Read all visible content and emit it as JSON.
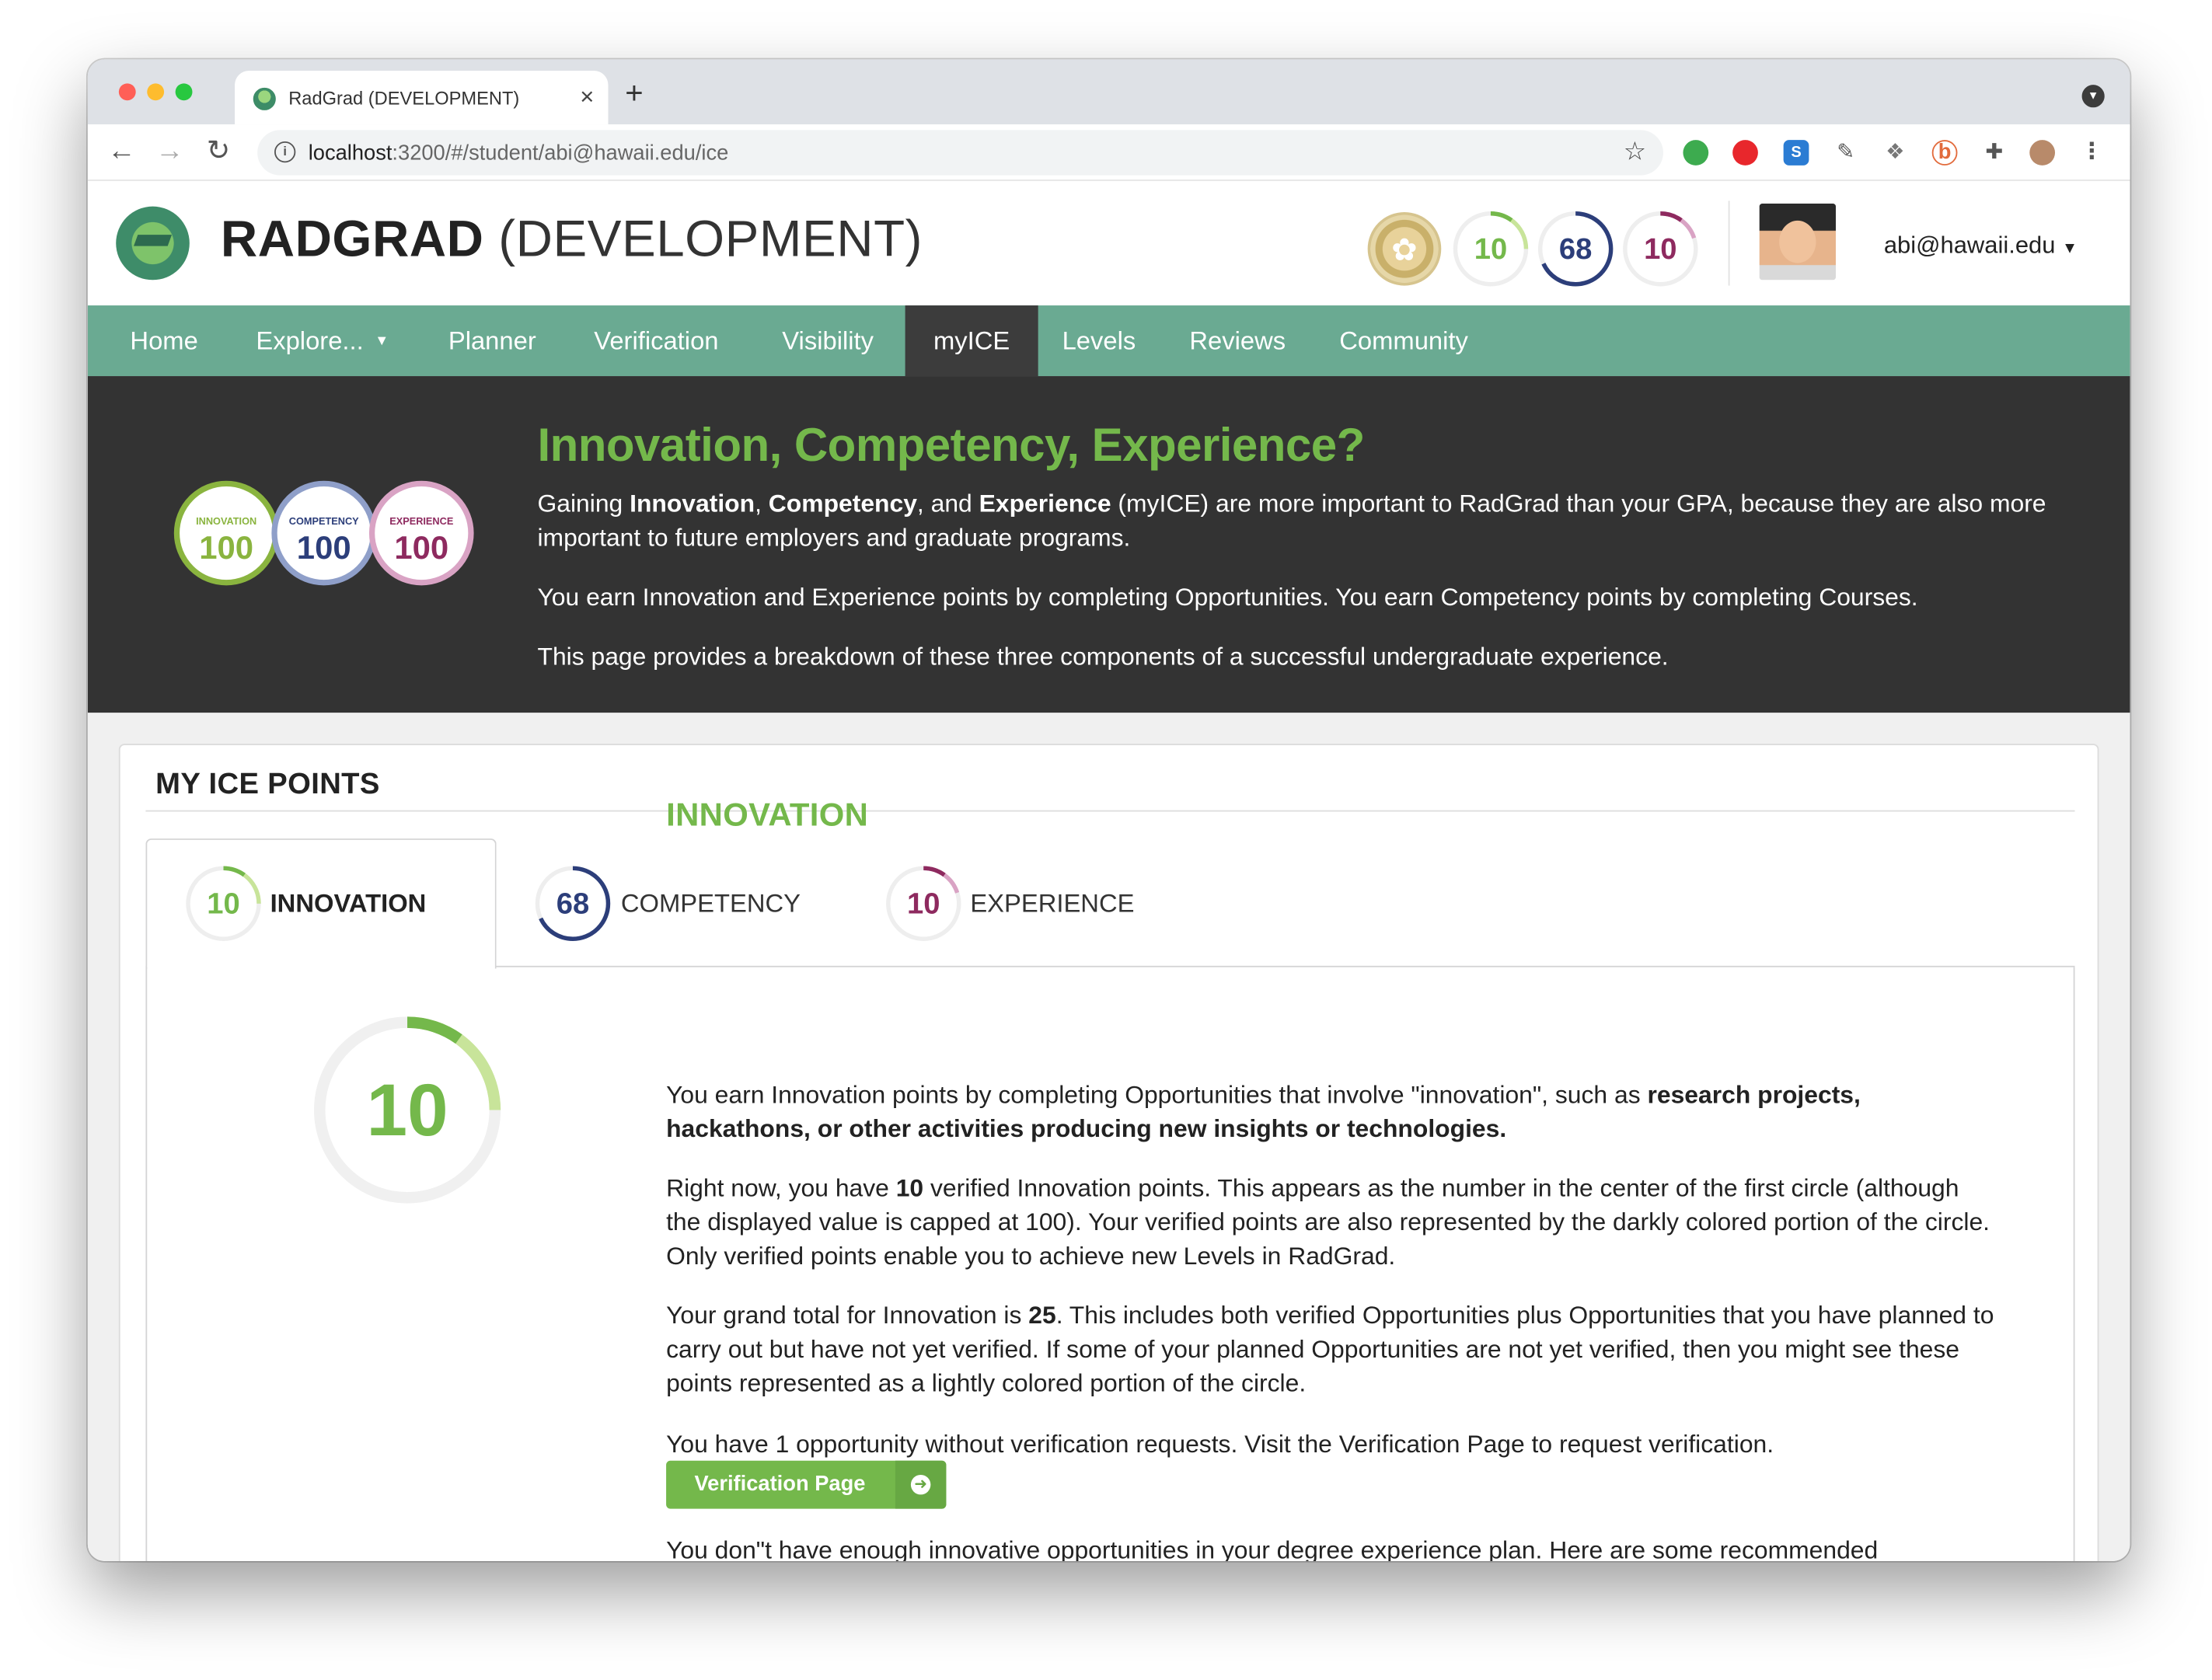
{
  "browser": {
    "tab_title": "RadGrad (DEVELOPMENT)",
    "tab_close": "×",
    "new_tab": "+",
    "url_host": "localhost",
    "url_path": ":3200/#/student/abi@hawaii.edu/ice"
  },
  "header": {
    "brand_bold": "RADGRAD",
    "brand_rest": " (DEVELOPMENT)",
    "innovation_points": "10",
    "competency_points": "68",
    "experience_points": "10",
    "user_email": "abi@hawaii.edu"
  },
  "menu": [
    {
      "label": "Home"
    },
    {
      "label": "Explore..."
    },
    {
      "label": "Planner"
    },
    {
      "label": "Verification"
    },
    {
      "label": "Visibility"
    },
    {
      "label": "myICE"
    },
    {
      "label": "Levels"
    },
    {
      "label": "Reviews"
    },
    {
      "label": "Community"
    }
  ],
  "banner": {
    "title": "Innovation, Competency, Experience?",
    "p1_pre": "Gaining ",
    "p1_b1": "Innovation",
    "p1_c1": ", ",
    "p1_b2": "Competency",
    "p1_c2": ", and ",
    "p1_b3": "Experience",
    "p1_post": " (myICE) are more important to RadGrad than your GPA, because they are also more important to future employers and graduate programs.",
    "p2": "You earn Innovation and Experience points by completing Opportunities. You earn Competency points by completing Courses.",
    "p3": "This page provides a breakdown of these three components of a successful undergraduate experience.",
    "bubbles": [
      {
        "label": "INNOVATION",
        "value": "100",
        "color": "#8ab43f"
      },
      {
        "label": "COMPETENCY",
        "value": "100",
        "color": "#2c3e7a"
      },
      {
        "label": "EXPERIENCE",
        "value": "100",
        "color": "#8e2a5f"
      }
    ]
  },
  "ice_card": {
    "heading": "MY ICE POINTS",
    "tabs": [
      {
        "value": "10",
        "label": "INNOVATION"
      },
      {
        "value": "68",
        "label": "COMPETENCY"
      },
      {
        "value": "10",
        "label": "EXPERIENCE"
      }
    ],
    "big_value": "10",
    "section_title": "INNOVATION",
    "p1_pre": "You earn Innovation points by completing Opportunities that involve \"innovation\", such as ",
    "p1_bold": "research projects, hackathons, or other activities producing new insights or technologies.",
    "p2_pre": "Right now, you have ",
    "p2_bold": "10",
    "p2_post": " verified Innovation points. This appears as the number in the center of the first circle (although the displayed value is capped at 100). Your verified points are also represented by the darkly colored portion of the circle. Only verified points enable you to achieve new Levels in RadGrad.",
    "p3_pre": "Your grand total for Innovation is ",
    "p3_bold": "25",
    "p3_post": ". This includes both verified Opportunities plus Opportunities that you have planned to carry out but have not yet verified. If some of your planned Opportunities are not yet verified, then you might see these points represented as a lightly colored portion of the circle.",
    "p4": "You have 1 opportunity without verification requests. Visit the Verification Page to request verification.",
    "button_label": "Verification Page",
    "p5": "You don\"t have enough innovative opportunities in your degree experience plan. Here are some recommended"
  },
  "progress": {
    "innovation_verified_fraction": 0.1,
    "innovation_planned_fraction": 0.25,
    "competency_fraction": 0.68,
    "experience_verified_fraction": 0.1,
    "experience_planned_fraction": 0.2
  },
  "colors": {
    "innovation": "#74b84b",
    "innovation_light": "#c8e49a",
    "competency": "#2c3e7a",
    "competency_light": "#8f9fc9",
    "experience": "#8e2a5f",
    "experience_light": "#d9a3c4",
    "menu_bg": "#6aaa92",
    "banner_bg": "#333333"
  }
}
